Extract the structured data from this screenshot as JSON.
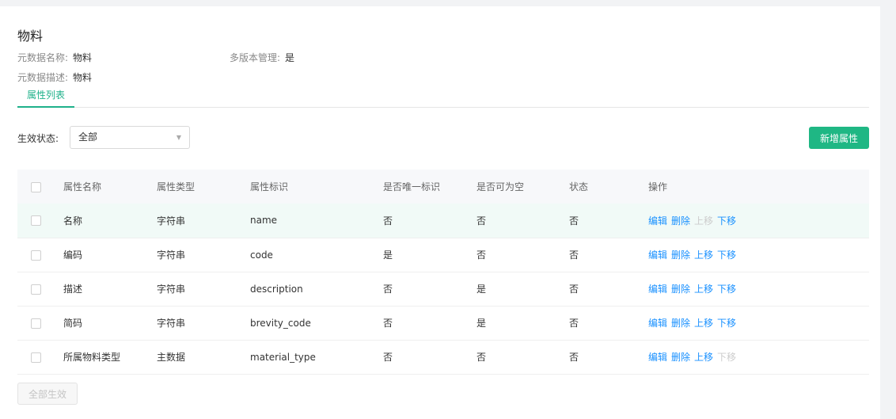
{
  "header": {
    "title": "物料",
    "meta_name_label": "元数据名称:",
    "meta_name_value": "物料",
    "multi_version_label": "多版本管理:",
    "multi_version_value": "是",
    "meta_desc_label": "元数据描述:",
    "meta_desc_value": "物料"
  },
  "tabs": [
    {
      "label": "属性列表",
      "active": true
    }
  ],
  "filter": {
    "label": "生效状态:",
    "selected": "全部",
    "arrow": "▼"
  },
  "actions": {
    "add_label": "新增属性",
    "apply_all_label": "全部生效"
  },
  "table": {
    "columns": [
      "属性名称",
      "属性类型",
      "属性标识",
      "是否唯一标识",
      "是否可为空",
      "状态",
      "操作"
    ],
    "rows": [
      {
        "name": "名称",
        "type": "字符串",
        "key": "name",
        "unique": "否",
        "nullable": "否",
        "status": "否",
        "ops": [
          {
            "label": "编辑",
            "enabled": true
          },
          {
            "label": "删除",
            "enabled": true
          },
          {
            "label": "上移",
            "enabled": false
          },
          {
            "label": "下移",
            "enabled": true
          }
        ]
      },
      {
        "name": "编码",
        "type": "字符串",
        "key": "code",
        "unique": "是",
        "nullable": "否",
        "status": "否",
        "ops": [
          {
            "label": "编辑",
            "enabled": true
          },
          {
            "label": "删除",
            "enabled": true
          },
          {
            "label": "上移",
            "enabled": true
          },
          {
            "label": "下移",
            "enabled": true
          }
        ]
      },
      {
        "name": "描述",
        "type": "字符串",
        "key": "description",
        "unique": "否",
        "nullable": "是",
        "status": "否",
        "ops": [
          {
            "label": "编辑",
            "enabled": true
          },
          {
            "label": "删除",
            "enabled": true
          },
          {
            "label": "上移",
            "enabled": true
          },
          {
            "label": "下移",
            "enabled": true
          }
        ]
      },
      {
        "name": "简码",
        "type": "字符串",
        "key": "brevity_code",
        "unique": "否",
        "nullable": "是",
        "status": "否",
        "ops": [
          {
            "label": "编辑",
            "enabled": true
          },
          {
            "label": "删除",
            "enabled": true
          },
          {
            "label": "上移",
            "enabled": true
          },
          {
            "label": "下移",
            "enabled": true
          }
        ]
      },
      {
        "name": "所属物料类型",
        "type": "主数据",
        "key": "material_type",
        "unique": "否",
        "nullable": "否",
        "status": "否",
        "ops": [
          {
            "label": "编辑",
            "enabled": true
          },
          {
            "label": "删除",
            "enabled": true
          },
          {
            "label": "上移",
            "enabled": true
          },
          {
            "label": "下移",
            "enabled": false
          }
        ]
      }
    ]
  },
  "colors": {
    "accent": "#1fb784",
    "link": "#1890ff",
    "disabled": "#cccccc",
    "row_highlight": "#f1faf7"
  }
}
